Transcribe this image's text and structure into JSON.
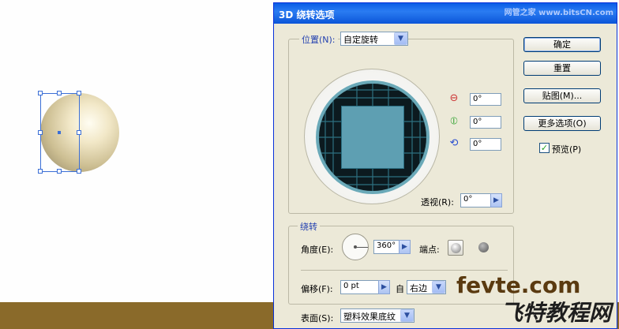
{
  "dialog": {
    "title": "3D 绕转选项",
    "watermark": "网管之家 www.bitsCN.com"
  },
  "position": {
    "label": "位置(N):",
    "preset": "自定旋转",
    "x_angle": "0°",
    "y_angle": "0°",
    "z_angle": "0°",
    "perspective_label": "透视(R):",
    "perspective_value": "0°"
  },
  "revolve": {
    "legend": "绕转",
    "angle_label": "角度(E):",
    "angle_value": "360°",
    "cap_label": "端点:",
    "offset_label": "偏移(F):",
    "offset_value": "0 pt",
    "from_label": "自",
    "from_value": "右边"
  },
  "surface": {
    "label": "表面(S):",
    "value": "塑料效果底纹"
  },
  "buttons": {
    "ok": "确定",
    "reset": "重置",
    "map": "贴图(M)...",
    "more_options": "更多选项(O)",
    "preview_label": "预览(P)"
  },
  "branding": {
    "site": "fevte.com",
    "name": "飞特教程网"
  },
  "colors": {
    "title_bar": "#0a5ce6",
    "dialog_bg": "#ece9d8",
    "ground": "#8a6a2a",
    "cube_face": "#5e9fb2",
    "selection": "#3b6fd6"
  },
  "icons": {
    "x_axis": "x-rotation-icon",
    "y_axis": "y-rotation-icon",
    "z_axis": "z-rotation-icon"
  }
}
